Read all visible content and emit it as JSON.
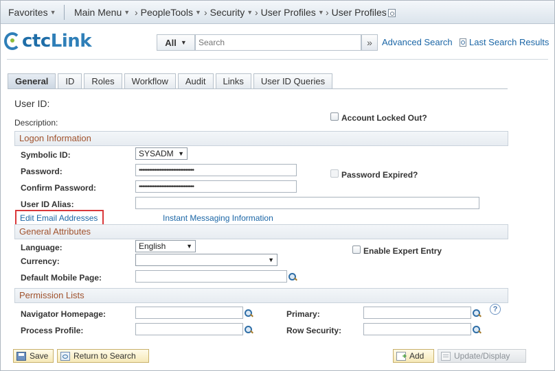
{
  "nav": {
    "favorites": "Favorites",
    "main_menu": "Main Menu",
    "breadcrumbs": [
      "PeopleTools",
      "Security",
      "User Profiles",
      "User Profiles"
    ]
  },
  "header": {
    "logo_prefix": "ctc",
    "logo_suffix": "Link",
    "search_scope": "All",
    "search_placeholder": "Search",
    "advanced_search": "Advanced Search",
    "last_search_results": "Last Search Results"
  },
  "tabs": [
    "General",
    "ID",
    "Roles",
    "Workflow",
    "Audit",
    "Links",
    "User ID Queries"
  ],
  "active_tab": "General",
  "form": {
    "user_id_label": "User ID:",
    "description_label": "Description:",
    "account_locked_label": "Account Locked Out?",
    "logon_section": "Logon Information",
    "symbolic_id_label": "Symbolic ID:",
    "symbolic_id_value": "SYSADM",
    "password_label": "Password:",
    "password_mask": "••••••••••••••••••••••••••••••••",
    "password_expired_label": "Password Expired?",
    "confirm_password_label": "Confirm Password:",
    "user_id_alias_label": "User ID Alias:",
    "edit_email_link": "Edit Email Addresses",
    "im_link": "Instant Messaging Information",
    "general_attributes_section": "General Attributes",
    "language_label": "Language:",
    "language_value": "English",
    "enable_expert_label": "Enable Expert Entry",
    "currency_label": "Currency:",
    "default_mobile_label": "Default Mobile Page:",
    "permission_section": "Permission Lists",
    "navigator_label": "Navigator Homepage:",
    "primary_label": "Primary:",
    "process_profile_label": "Process Profile:",
    "row_security_label": "Row Security:",
    "help_glyph": "?"
  },
  "toolbar": {
    "save": "Save",
    "return_to_search": "Return to Search",
    "add": "Add",
    "update_display": "Update/Display"
  },
  "colors": {
    "link": "#1b66a6",
    "section_title": "#a0522d",
    "highlight_box": "#d9383a",
    "logo_blue": "#1f6ea8"
  }
}
